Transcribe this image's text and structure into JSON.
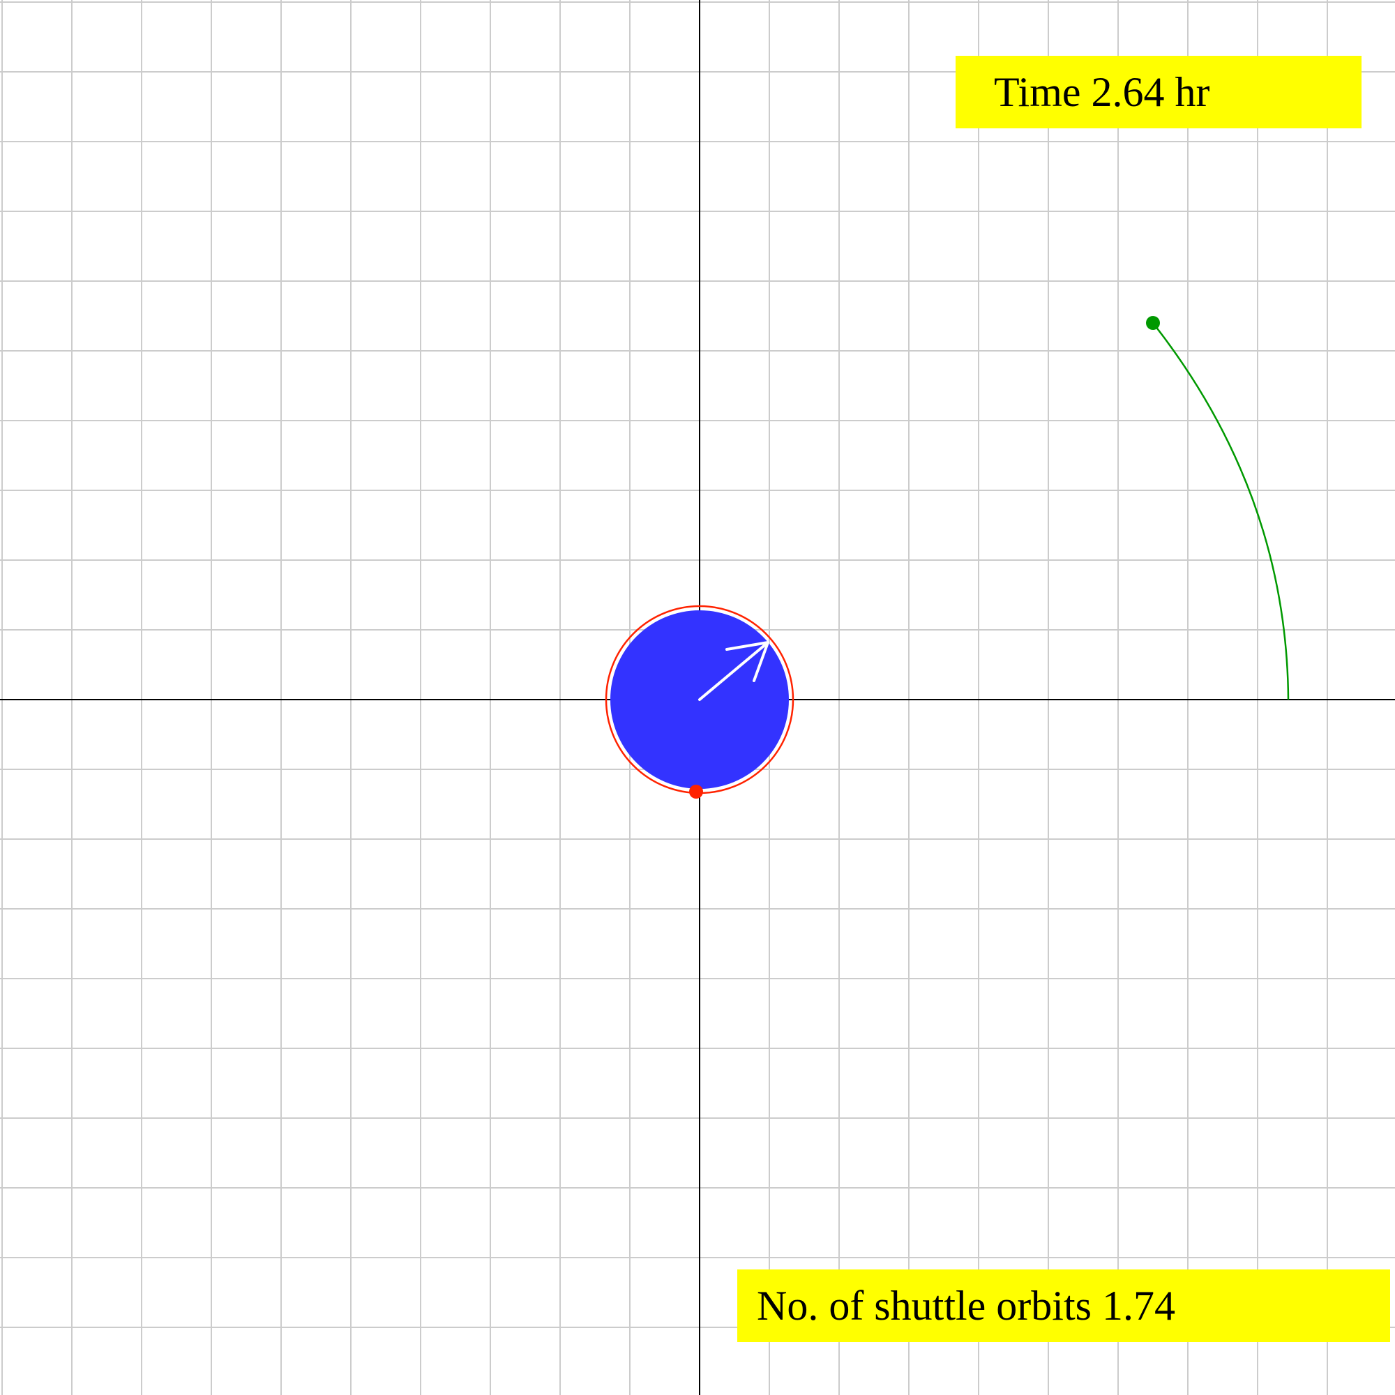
{
  "time_label": {
    "prefix": "Time",
    "value": "2.64",
    "unit": "hr"
  },
  "orbits_label": {
    "prefix": "No. of shuttle orbits",
    "value": "1.74"
  },
  "colors": {
    "grid": "#cccccc",
    "axes": "#000000",
    "earth": "#3333ff",
    "shuttle_orbit": "#ff2200",
    "shuttle": "#ff2200",
    "moon_path": "#009900",
    "moon": "#009900",
    "arrow": "#ffffff",
    "label_bg": "#ffff00"
  },
  "icons": {
    "earth": "filled-circle",
    "rotation_arrow": "white-arrow",
    "shuttle": "red-dot",
    "moon": "green-dot"
  }
}
